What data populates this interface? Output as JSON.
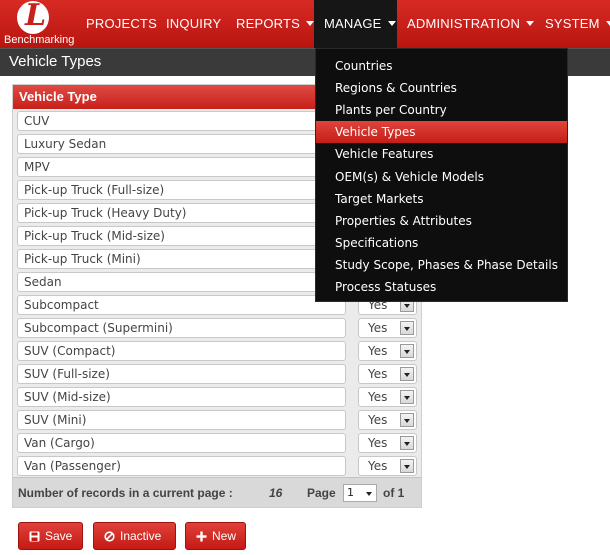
{
  "brand": {
    "logo_letter": "L",
    "name": "Benchmarking"
  },
  "nav": {
    "items": [
      {
        "label": "PROJECTS",
        "caret": false,
        "active": false
      },
      {
        "label": "INQUIRY",
        "caret": false,
        "active": false
      },
      {
        "label": "REPORTS",
        "caret": true,
        "active": false
      },
      {
        "label": "MANAGE",
        "caret": true,
        "active": true
      },
      {
        "label": "ADMINISTRATION",
        "caret": true,
        "active": false
      },
      {
        "label": "SYSTEM",
        "caret": true,
        "active": false
      }
    ]
  },
  "page": {
    "title": "Vehicle Types"
  },
  "table": {
    "header": "Vehicle Type",
    "rows": [
      {
        "name": "CUV",
        "status": ""
      },
      {
        "name": "Luxury Sedan",
        "status": ""
      },
      {
        "name": "MPV",
        "status": ""
      },
      {
        "name": "Pick-up Truck (Full-size)",
        "status": ""
      },
      {
        "name": "Pick-up Truck (Heavy Duty)",
        "status": ""
      },
      {
        "name": "Pick-up Truck (Mid-size)",
        "status": ""
      },
      {
        "name": "Pick-up Truck (Mini)",
        "status": ""
      },
      {
        "name": "Sedan",
        "status": ""
      },
      {
        "name": "Subcompact",
        "status": "Yes"
      },
      {
        "name": "Subcompact (Supermini)",
        "status": "Yes"
      },
      {
        "name": "SUV (Compact)",
        "status": "Yes"
      },
      {
        "name": "SUV (Full-size)",
        "status": "Yes"
      },
      {
        "name": "SUV (Mid-size)",
        "status": "Yes"
      },
      {
        "name": "SUV (Mini)",
        "status": "Yes"
      },
      {
        "name": "Van (Cargo)",
        "status": "Yes"
      },
      {
        "name": "Van (Passenger)",
        "status": "Yes"
      }
    ],
    "footer": {
      "records_label": "Number of records in a current page :",
      "records_count": "16",
      "page_label": "Page",
      "page_value": "1",
      "of_label": "of 1"
    }
  },
  "buttons": {
    "save": "Save",
    "inactive": "Inactive",
    "new": "New"
  },
  "manage_menu": {
    "items": [
      {
        "label": "Countries",
        "active": false
      },
      {
        "label": "Regions & Countries",
        "active": false
      },
      {
        "label": "Plants per Country",
        "active": false
      },
      {
        "label": "Vehicle Types",
        "active": true
      },
      {
        "label": "Vehicle Features",
        "active": false
      },
      {
        "label": "OEM(s) & Vehicle Models",
        "active": false
      },
      {
        "label": "Target Markets",
        "active": false
      },
      {
        "label": "Properties & Attributes",
        "active": false
      },
      {
        "label": "Specifications",
        "active": false
      },
      {
        "label": "Study Scope, Phases & Phase Details",
        "active": false
      },
      {
        "label": "Process Statuses",
        "active": false
      }
    ]
  },
  "colors": {
    "accent": "#c8201b",
    "dark": "#161616"
  }
}
